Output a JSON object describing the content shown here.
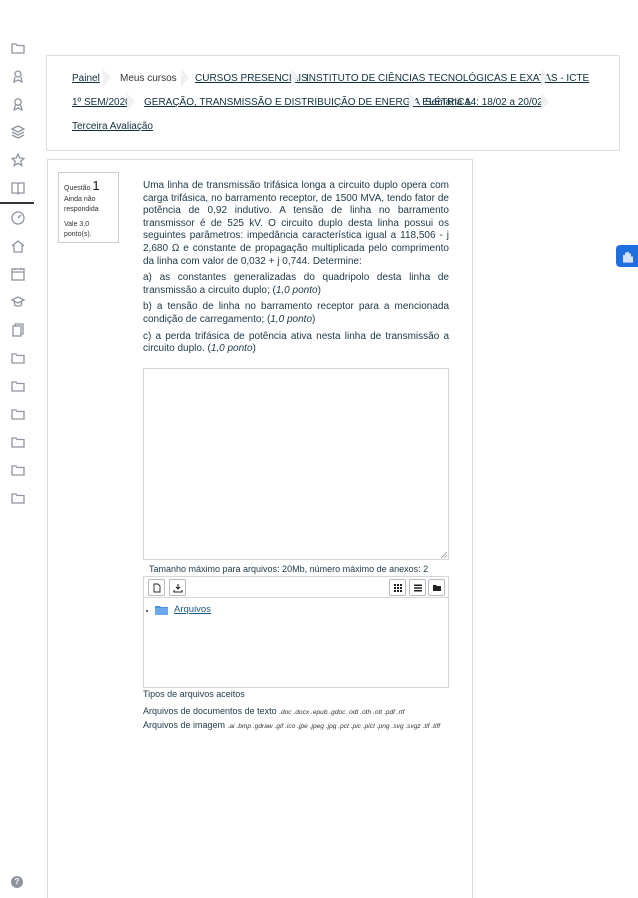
{
  "breadcrumb": {
    "painel": "Painel",
    "meus_cursos": "Meus cursos",
    "presenciais": "CURSOS PRESENCIAIS",
    "instituto": "INSTITUTO DE CIÊNCIAS TECNOLÓGICAS E EXATAS - ICTE",
    "semestre": "1º SEM/2020",
    "disciplina": "GERAÇÃO, TRANSMISSÃO E DISTRIBUIÇÃO DE ENERGIA ELÉTRICA",
    "semana": "Semana 14: 18/02 a 20/02",
    "avaliacao": "Terceira Avaliação"
  },
  "question": {
    "label": "Questão",
    "number": "1",
    "status": "Ainda não respondida",
    "grade": "Vale 3,0 ponto(s).",
    "intro": "Uma linha de transmissão trifásica longa a circuito duplo opera com carga trifásica, no barramento receptor, de 1500 MVA, tendo fator de potência de 0,92 indutivo. A tensão de linha no barramento transmissor é de 525 kV. O circuito duplo desta linha possui os seguintes parâmetros: impedância característica igual a 118,506 - j 2,680 Ω e constante de propagação multiplicada pelo comprimento da linha com valor de 0,032 + j 0,744. Determine:",
    "item_a": "a) as constantes generalizadas do quadripolo desta linha de transmissão a circuito duplo; (",
    "item_a_pts": "1,0 ponto",
    "item_b": "b) a tensão de linha no barramento receptor para a mencionada condição de carregamento; (",
    "item_b_pts": "1,0 ponto",
    "item_c": "c) a perda trifásica de potência ativa nesta linha de transmissão a circuito duplo. (",
    "item_c_pts": "1,0 ponto",
    "close_paren": ")"
  },
  "filemanager": {
    "max_info": "Tamanho máximo para arquivos: 20Mb, número máximo de anexos: 2",
    "folder_label": "Arquivos",
    "accepted_title": "Tipos de arquivos aceitos",
    "doc_label": "Arquivos de documentos de texto",
    "doc_ext": ".doc .docx .epub .gdoc .odt .oth .ott .pdf .rtf",
    "img_label": "Arquivos de imagem",
    "img_ext": ".ai .bmp .gdraw .gif .ico .jpe .jpeg .jpg .pct .pic .pict .png .svg .svgz .tif .tiff"
  },
  "help_label": "?",
  "colors": {
    "accent": "#1f6fe0",
    "link": "#1a5a86",
    "rail_icon": "#8f959e"
  }
}
